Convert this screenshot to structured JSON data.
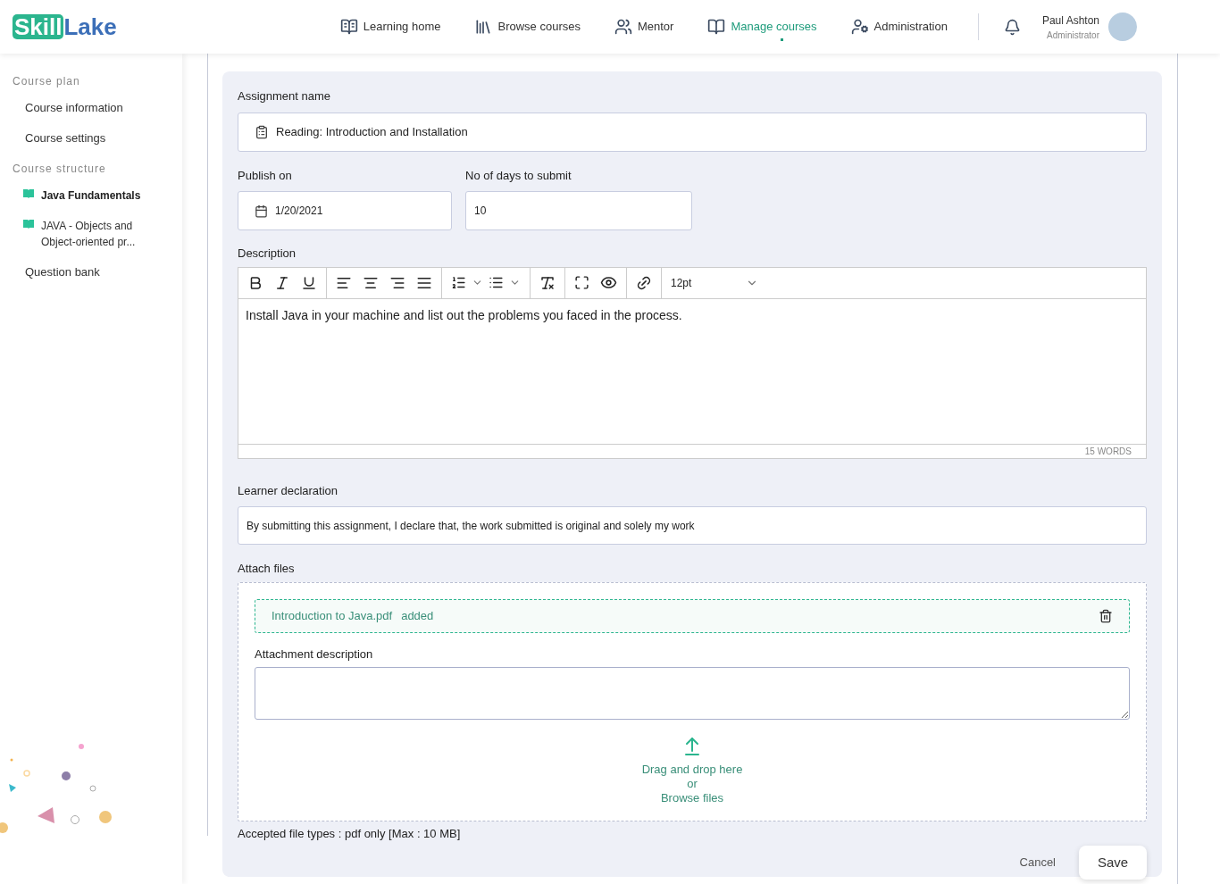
{
  "logo": {
    "part_1": "Skill",
    "part_2": "Lake"
  },
  "nav": [
    {
      "label": "Learning home",
      "selected": false
    },
    {
      "label": "Browse courses",
      "selected": false
    },
    {
      "label": "Mentor",
      "selected": false
    },
    {
      "label": "Manage courses",
      "selected": true
    },
    {
      "label": "Administration",
      "selected": false
    }
  ],
  "user": {
    "name": "Paul Ashton",
    "role": "Administrator"
  },
  "sidebar": [
    {
      "heading": "Course plan",
      "items": [
        {
          "label": "Course information",
          "kind": "link",
          "selected": false
        },
        {
          "label": "Course settings",
          "kind": "link",
          "selected": false
        }
      ]
    },
    {
      "heading": "Course structure",
      "items": [
        {
          "label": "Java Fundamentals",
          "kind": "module",
          "selected": true
        },
        {
          "label": "JAVA - Objects and Object-oriented pr...",
          "kind": "module",
          "selected": false
        },
        {
          "label": "Question bank",
          "kind": "link",
          "selected": false
        }
      ]
    }
  ],
  "form": {
    "assignment_name": {
      "label": "Assignment name",
      "value": "Reading: Introduction and Installation"
    },
    "publish_on": {
      "label": "Publish on",
      "value": "1/20/2021"
    },
    "days_to_submit": {
      "label": "No of days to submit",
      "value": "10"
    },
    "description": {
      "label": "Description",
      "font_size": "12pt",
      "text": "Install Java in your machine and list out the problems you faced in the process.",
      "word_count": "15 WORDS"
    },
    "learner_declaration": {
      "label": "Learner declaration",
      "value": "By submitting this assignment, I declare that, the work submitted is original and solely my work"
    },
    "attach": {
      "label": "Attach files",
      "file_name": "Introduction to Java.pdf",
      "file_status": "added",
      "description_label": "Attachment description",
      "drop_text": "Drag and drop here",
      "or_text": "or",
      "browse": "Browse files",
      "accepted": "Accepted file types : pdf only [Max : 10 MB]"
    },
    "buttons": {
      "cancel": "Cancel",
      "save": "Save"
    }
  }
}
